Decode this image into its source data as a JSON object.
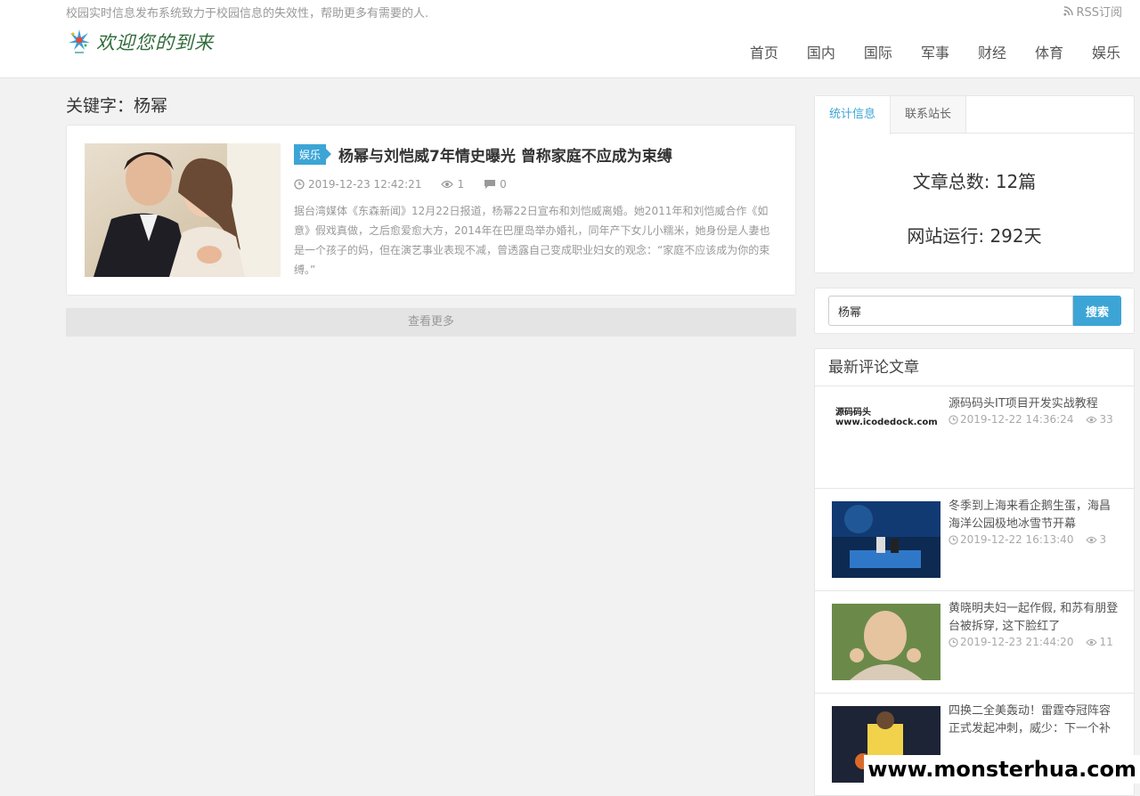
{
  "header": {
    "slogan": "校园实时信息发布系统致力于校园信息的失效性，帮助更多有需要的人.",
    "rss": "RSS订阅",
    "logo_text": "欢迎您的到来",
    "nav": [
      "首页",
      "国内",
      "国际",
      "军事",
      "财经",
      "体育",
      "娱乐"
    ]
  },
  "main": {
    "keyword_title": "关键字：杨幂",
    "article": {
      "tag": "娱乐",
      "title": "杨幂与刘恺威7年情史曝光 曾称家庭不应成为束缚",
      "date": "2019-12-23 12:42:21",
      "views": "1",
      "comments": "0",
      "summary": "据台湾媒体《东森新闻》12月22日报道，杨幂22日宣布和刘恺威离婚。她2011年和刘恺威合作《如意》假戏真做，之后愈爱愈大方，2014年在巴厘岛举办婚礼，同年产下女儿小糯米，她身份是人妻也是一个孩子的妈，但在演艺事业表现不减，曾透露自己变成职业妇女的观念：“家庭不应该成为你的束缚。”"
    },
    "more": "查看更多"
  },
  "sidebar": {
    "tabs": [
      "统计信息",
      "联系站长"
    ],
    "stats": {
      "article_count": "文章总数: 12篇",
      "run_days": "网站运行: 292天"
    },
    "search": {
      "value": "杨幂",
      "button": "搜索"
    },
    "recent": {
      "title": "最新评论文章",
      "items": [
        {
          "title": "源码码头IT项目开发实战教程",
          "date": "2019-12-22 14:36:24",
          "views": "33",
          "thumb_line1": "源码码头",
          "thumb_line2": "www.icodedock.com"
        },
        {
          "title": "冬季到上海来看企鹅生蛋，海昌海洋公园极地冰雪节开幕",
          "date": "2019-12-22 16:13:40",
          "views": "3"
        },
        {
          "title": "黄晓明夫妇一起作假, 和苏有朋登台被拆穿, 这下脸红了",
          "date": "2019-12-23 21:44:20",
          "views": "11"
        },
        {
          "title": "四换二全美轰动！雷霆夺冠阵容正式发起冲刺，威少：下一个补差转",
          "date": "",
          "views": ""
        }
      ]
    }
  },
  "watermark": "www.monsterhua.com"
}
